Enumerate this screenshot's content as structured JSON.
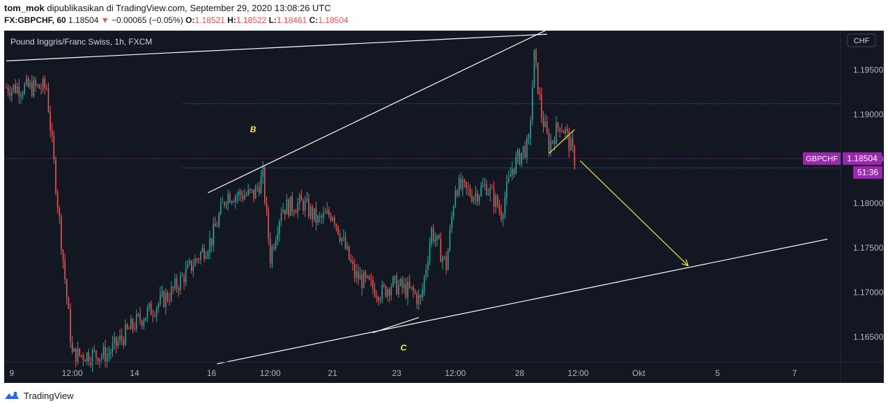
{
  "header": {
    "user": "tom_mok",
    "published": " dipublikasikan di TradingView.com, September 29, 2020 13:08:26 UTC",
    "symbol": "FX:GBPCHF, 60",
    "last": "1.18504",
    "change_arrow": "▼",
    "change": "−0.00065 (−0.05%)",
    "o_label": "O:",
    "o_value": "1.18521",
    "h_label": "H:",
    "h_value": "1.18522",
    "l_label": "L:",
    "l_value": "1.18461",
    "c_label": "C:",
    "c_value": "1.18504"
  },
  "footer": {
    "brand": "TradingView",
    "logo_icon": "tradingview-logo-icon"
  },
  "colors": {
    "background": "#131722",
    "up": "#26a69a",
    "down": "#ef5350",
    "price_tag": "#9c27b0",
    "arrow": "#f2e94e",
    "hline": "#2d8ba8"
  },
  "chart_data": {
    "type": "candlestick",
    "title": "Pound Inggris/Franc Swiss, 1h, FXCM",
    "currency": "CHF",
    "ylim": [
      1.1622,
      1.1994
    ],
    "y_ticks": [
      "1.16500",
      "1.17000",
      "1.17500",
      "1.18000",
      "1.18500",
      "1.19000",
      "1.19500"
    ],
    "x_ticks": [
      "9",
      "12:00",
      "14",
      "16",
      "12:00",
      "21",
      "23",
      "12:00",
      "28",
      "12:00",
      "Okt",
      "5",
      "7"
    ],
    "x_tick_index": [
      3,
      36,
      70,
      112,
      144,
      178,
      213,
      245,
      280,
      312,
      345,
      388,
      430
    ],
    "last_price": {
      "label": "GBPCHF",
      "value": "1.18504",
      "countdown": "51:36"
    },
    "horizontal_levels": [
      1.1912,
      1.184
    ],
    "price_line": 1.18504,
    "anchors": [
      {
        "i": 0,
        "y": 1.193
      },
      {
        "i": 22,
        "y": 1.193
      },
      {
        "i": 36,
        "y": 1.163
      },
      {
        "i": 55,
        "y": 1.163
      },
      {
        "i": 70,
        "y": 1.1665
      },
      {
        "i": 90,
        "y": 1.17
      },
      {
        "i": 112,
        "y": 1.176
      },
      {
        "i": 120,
        "y": 1.181
      },
      {
        "i": 135,
        "y": 1.181
      },
      {
        "i": 140,
        "y": 1.183
      },
      {
        "i": 144,
        "y": 1.174
      },
      {
        "i": 150,
        "y": 1.1795
      },
      {
        "i": 162,
        "y": 1.18
      },
      {
        "i": 170,
        "y": 1.178
      },
      {
        "i": 178,
        "y": 1.179
      },
      {
        "i": 190,
        "y": 1.172
      },
      {
        "i": 200,
        "y": 1.1705
      },
      {
        "i": 205,
        "y": 1.17
      },
      {
        "i": 210,
        "y": 1.171
      },
      {
        "i": 222,
        "y": 1.17
      },
      {
        "i": 226,
        "y": 1.169
      },
      {
        "i": 232,
        "y": 1.177
      },
      {
        "i": 240,
        "y": 1.173
      },
      {
        "i": 245,
        "y": 1.182
      },
      {
        "i": 255,
        "y": 1.181
      },
      {
        "i": 262,
        "y": 1.182
      },
      {
        "i": 266,
        "y": 1.1805
      },
      {
        "i": 270,
        "y": 1.179
      },
      {
        "i": 276,
        "y": 1.184
      },
      {
        "i": 282,
        "y": 1.186
      },
      {
        "i": 285,
        "y": 1.1865
      },
      {
        "i": 288,
        "y": 1.1965
      },
      {
        "i": 292,
        "y": 1.19
      },
      {
        "i": 296,
        "y": 1.1865
      },
      {
        "i": 302,
        "y": 1.189
      },
      {
        "i": 305,
        "y": 1.188
      },
      {
        "i": 310,
        "y": 1.185
      }
    ],
    "annotations": [
      {
        "text": "B",
        "x": 133,
        "y": 1.188
      },
      {
        "text": "C",
        "x": 215,
        "y": 1.1635
      }
    ],
    "lines": [
      {
        "name": "upper-channel",
        "i1": 0,
        "y1": 1.196,
        "i2": 295,
        "y2": 1.199,
        "color": "#ffffff"
      },
      {
        "name": "upper-trendline",
        "i1": 110,
        "y1": 1.1812,
        "i2": 295,
        "y2": 1.1995,
        "color": "#ffffff"
      },
      {
        "name": "lower-trendline",
        "i1": 115,
        "y1": 1.162,
        "i2": 448,
        "y2": 1.176,
        "color": "#ffffff"
      },
      {
        "name": "c-support",
        "i1": 200,
        "y1": 1.1655,
        "i2": 225,
        "y2": 1.1672,
        "color": "#ffffff"
      },
      {
        "name": "flag-line",
        "i1": 296,
        "y1": 1.1856,
        "i2": 310,
        "y2": 1.1883,
        "color": "#f2e94e"
      }
    ],
    "forecast_arrow": {
      "i1": 313,
      "y1": 1.1848,
      "i2": 372,
      "y2": 1.173
    }
  }
}
